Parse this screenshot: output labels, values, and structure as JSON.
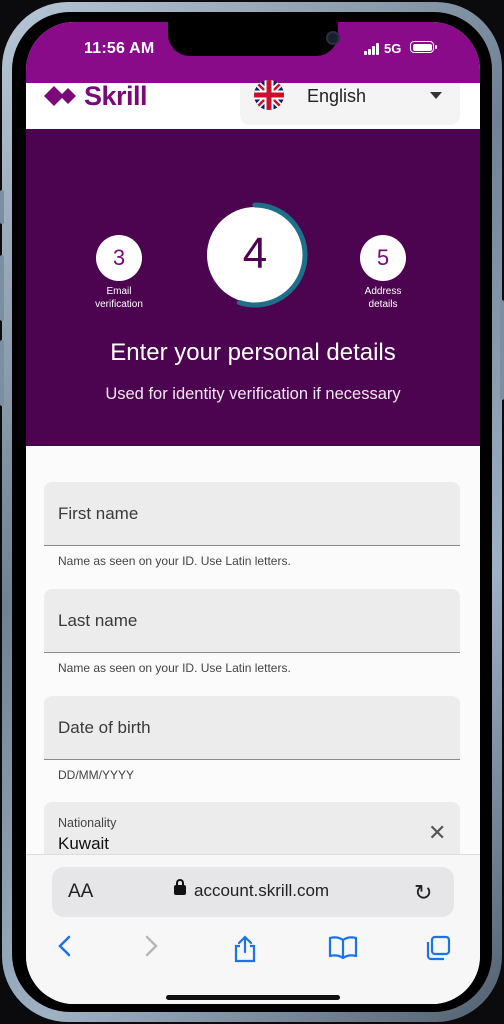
{
  "status_bar": {
    "time": "11:56 AM",
    "network": "5G"
  },
  "header": {
    "brand": "Skrill",
    "language": {
      "selected": "English",
      "flag": "uk-flag-icon"
    }
  },
  "steps": {
    "previous": {
      "number": "3",
      "caption_line1": "Email",
      "caption_line2": "verification"
    },
    "current": {
      "number": "4",
      "progress": 0.55
    },
    "next": {
      "number": "5",
      "caption_line1": "Address",
      "caption_line2": "details"
    }
  },
  "hero": {
    "title": "Enter your personal details",
    "subtitle": "Used for identity verification if necessary"
  },
  "form": {
    "first_name": {
      "label": "First name",
      "hint": "Name as seen on your ID. Use Latin letters."
    },
    "last_name": {
      "label": "Last name",
      "hint": "Name as seen on your ID. Use Latin letters."
    },
    "dob": {
      "label": "Date of birth",
      "hint": "DD/MM/YYYY"
    },
    "nationality": {
      "label": "Nationality",
      "value": "Kuwait"
    }
  },
  "browser": {
    "text_size": "AA",
    "url": "account.skrill.com"
  },
  "colors": {
    "brand_purple": "#7a0a7a",
    "hero_bg": "#4c0450",
    "status_bar_bg": "#8a0b8a",
    "progress_ring": "#1f6f8b",
    "ios_blue": "#1a73e8"
  }
}
